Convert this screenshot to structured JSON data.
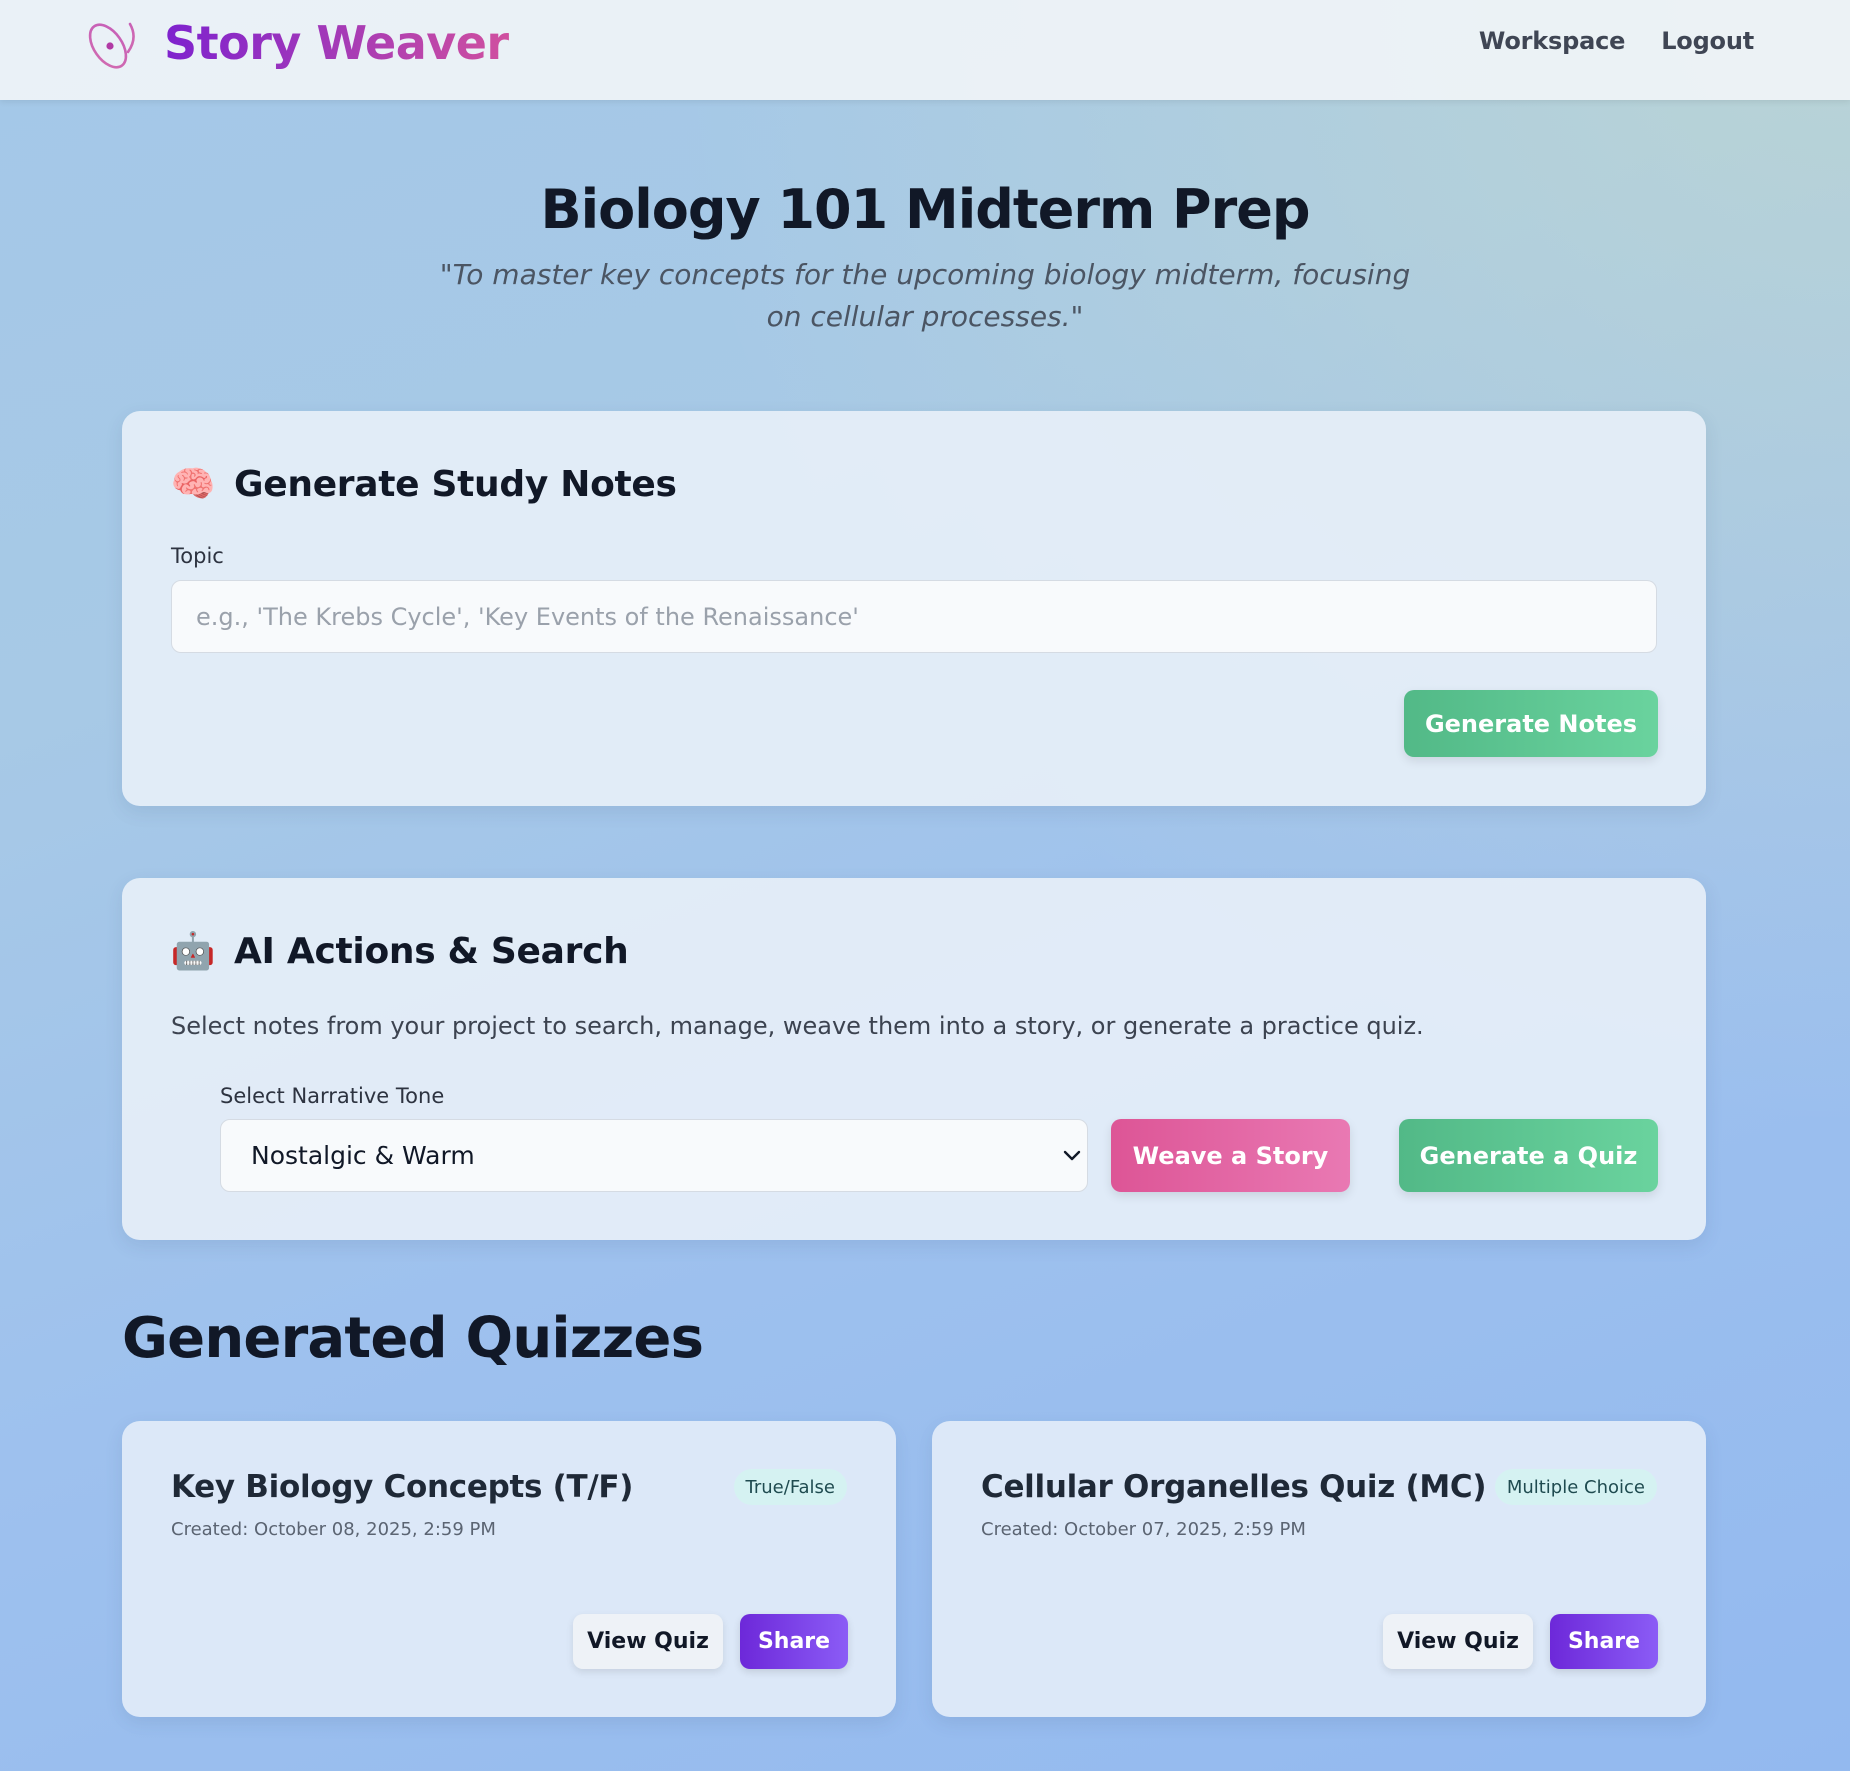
{
  "header": {
    "brand": "Story Weaver",
    "nav": {
      "workspace": "Workspace",
      "logout": "Logout"
    },
    "logo_icon": "orbit-logo-icon"
  },
  "hero": {
    "title": "Biology 101 Midterm Prep",
    "subtitle": "\"To master key concepts for the upcoming biology midterm, focusing on cellular processes.\""
  },
  "notes_card": {
    "emoji": "🧠",
    "heading": "Generate Study Notes",
    "topic_label": "Topic",
    "topic_value": "",
    "topic_placeholder": "e.g., 'The Krebs Cycle', 'Key Events of the Renaissance'",
    "generate_button": "Generate Notes"
  },
  "ai_card": {
    "emoji": "🤖",
    "heading": "AI Actions & Search",
    "description": "Select notes from your project to search, manage, weave them into a story, or generate a practice quiz.",
    "tone_label": "Select Narrative Tone",
    "tone_selected": "Nostalgic & Warm",
    "weave_button": "Weave a Story",
    "quiz_button": "Generate a Quiz"
  },
  "quizzes": {
    "section_title": "Generated Quizzes",
    "items": [
      {
        "title": "Key Biology Concepts (T/F)",
        "badge": "True/False",
        "created": "Created: October 08, 2025, 2:59 PM",
        "view_label": "View Quiz",
        "share_label": "Share"
      },
      {
        "title": "Cellular Organelles Quiz (MC)",
        "badge": "Multiple Choice",
        "created": "Created: October 07, 2025, 2:59 PM",
        "view_label": "View Quiz",
        "share_label": "Share"
      }
    ]
  },
  "colors": {
    "brand_purple": "#7e22ce",
    "brand_pink": "#d0509f",
    "green_button": "#52b987",
    "pink_button": "#dd5596",
    "share_purple": "#6d28d9"
  }
}
